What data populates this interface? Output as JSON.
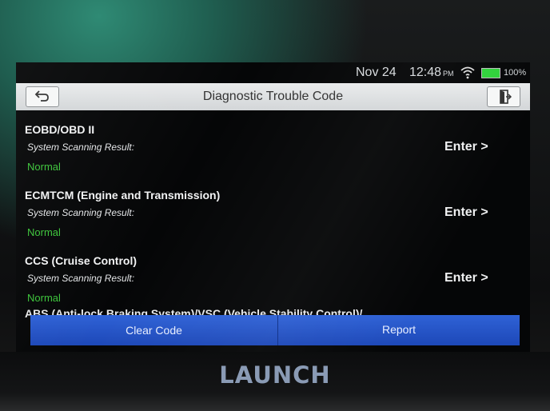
{
  "status_bar": {
    "date": "Nov 24",
    "time": "12:48",
    "ampm": "PM",
    "battery": "100%",
    "wifi_icon": "wifi-icon",
    "battery_icon": "battery-icon",
    "battery_color": "#2fd23a"
  },
  "header": {
    "title": "Diagnostic Trouble Code",
    "back_icon": "back-arrow-icon",
    "exit_icon": "exit-door-icon"
  },
  "systems": [
    {
      "name": "EOBD/OBD II",
      "label": "System Scanning Result:",
      "status": "Normal",
      "action": "Enter >"
    },
    {
      "name": "ECMTCM (Engine and Transmission)",
      "label": "System Scanning Result:",
      "status": "Normal",
      "action": "Enter >"
    },
    {
      "name": "CCS (Cruise Control)",
      "label": "System Scanning Result:",
      "status": "Normal",
      "action": "Enter >"
    },
    {
      "name": "ABS (Anti-lock Braking System)/VSC (Vehicle Stability Control)/"
    }
  ],
  "footer": {
    "clear_label": "Clear Code",
    "report_label": "Report",
    "accent": "#2f62d6"
  },
  "brand": "LAUNCH",
  "colors": {
    "normal_status": "#3cc43a",
    "screen_bg": "#050607"
  }
}
